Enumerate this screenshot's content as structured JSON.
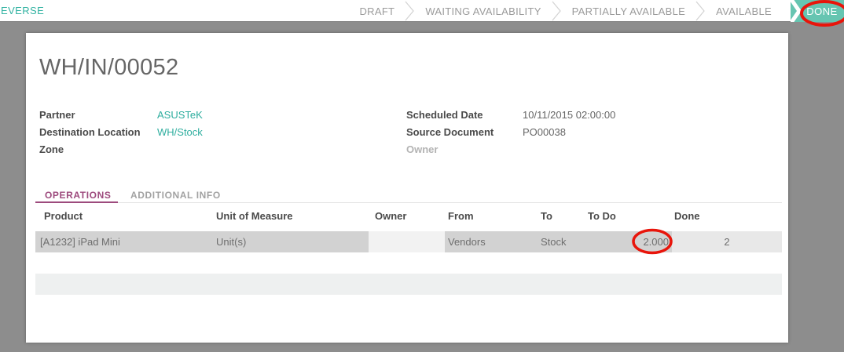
{
  "topbar": {
    "reverse_label": "EVERSE",
    "steps": [
      "DRAFT",
      "WAITING AVAILABILITY",
      "PARTIALLY AVAILABLE",
      "AVAILABLE"
    ],
    "done_label": "DONE"
  },
  "document": {
    "title": "WH/IN/00052",
    "fields_left": [
      {
        "label": "Partner",
        "value": "ASUSTeK"
      },
      {
        "label": "Destination Location Zone",
        "value": "WH/Stock"
      }
    ],
    "fields_right": [
      {
        "label": "Scheduled Date",
        "value": "10/11/2015 02:00:00"
      },
      {
        "label": "Source Document",
        "value": "PO00038"
      },
      {
        "label": "Owner",
        "value": ""
      }
    ],
    "tabs": [
      {
        "label": "OPERATIONS",
        "active": true
      },
      {
        "label": "ADDITIONAL INFO",
        "active": false
      }
    ],
    "table": {
      "headers": [
        "Product",
        "Unit of Measure",
        "Owner",
        "From",
        "To",
        "To Do",
        "Done"
      ],
      "rows": [
        {
          "product": "[A1232] iPad Mini",
          "uom": "Unit(s)",
          "owner": "",
          "from": "Vendors",
          "to": "Stock",
          "todo": "2.000",
          "done": "2"
        }
      ]
    }
  },
  "annotations": {
    "circle_1_target": "DONE",
    "circle_2_target": "2.000"
  },
  "colors": {
    "accent_teal": "#66c5b1",
    "link_teal": "#2fae9f",
    "tab_purple": "#9d4a7d",
    "annotation_red": "#e8150b",
    "background_gray": "#8d8d8d"
  }
}
